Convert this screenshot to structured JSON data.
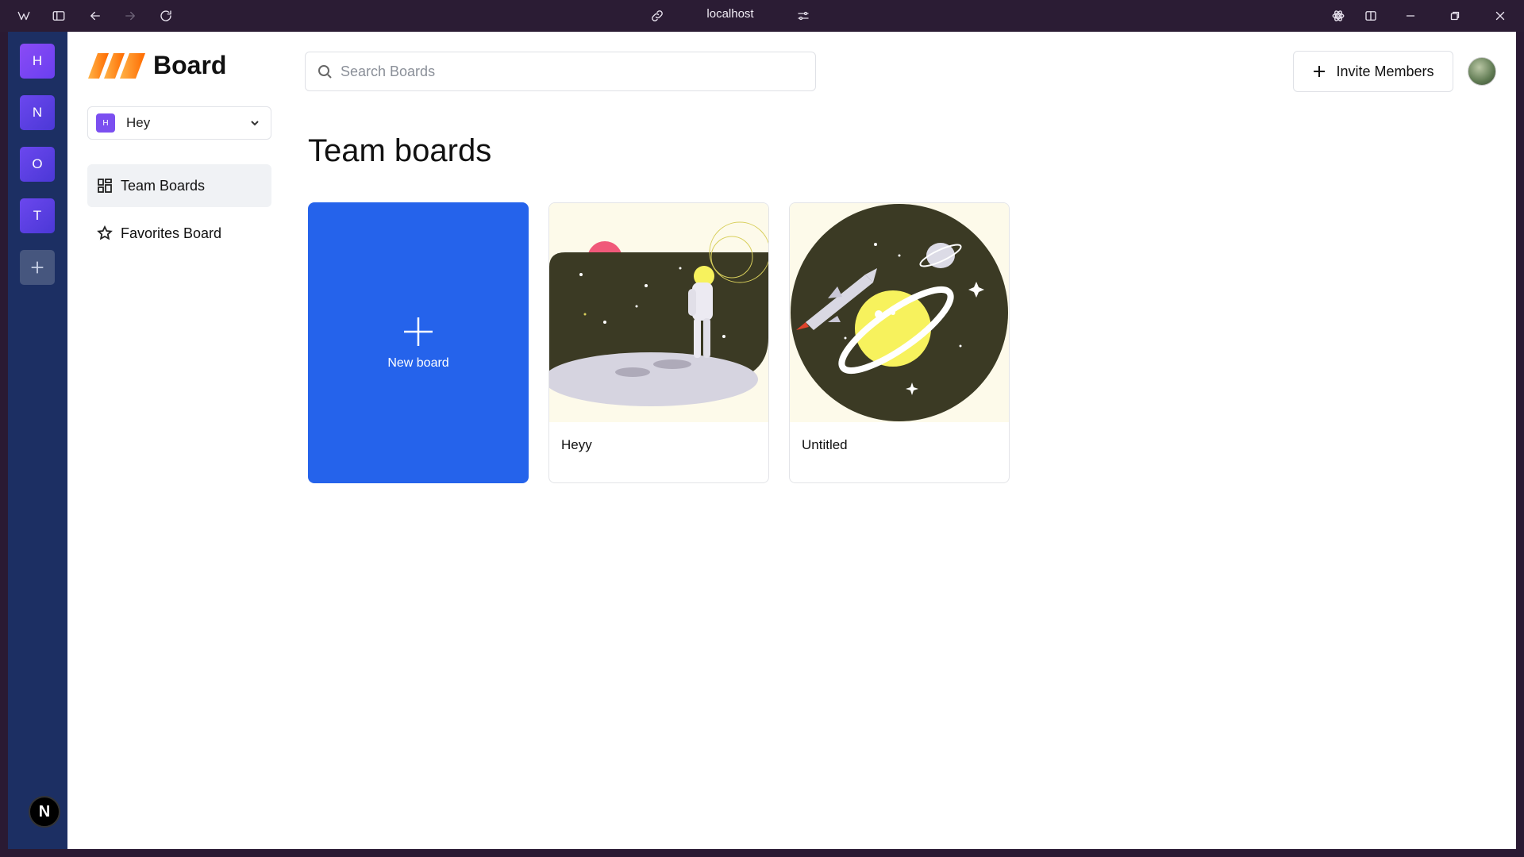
{
  "browser": {
    "url": "localhost"
  },
  "rail": {
    "orgs": [
      "H",
      "N",
      "O",
      "T"
    ],
    "bottom_badge": "N"
  },
  "sidebar": {
    "app_name": "Board",
    "org_selector": {
      "initial": "H",
      "name": "Hey"
    },
    "nav": [
      {
        "label": "Team Boards",
        "icon": "dashboard-icon",
        "active": true
      },
      {
        "label": "Favorites Board",
        "icon": "star-icon",
        "active": false
      }
    ]
  },
  "header": {
    "search_placeholder": "Search Boards",
    "invite_label": "Invite Members"
  },
  "main": {
    "title": "Team boards",
    "new_board_label": "New board",
    "boards": [
      {
        "name": "Heyy",
        "image": "astronaut-illustration"
      },
      {
        "name": "Untitled",
        "image": "planet-illustration"
      }
    ]
  },
  "colors": {
    "accent": "#2563eb",
    "rail": "#1c2f63",
    "chrome": "#2b1c34"
  }
}
